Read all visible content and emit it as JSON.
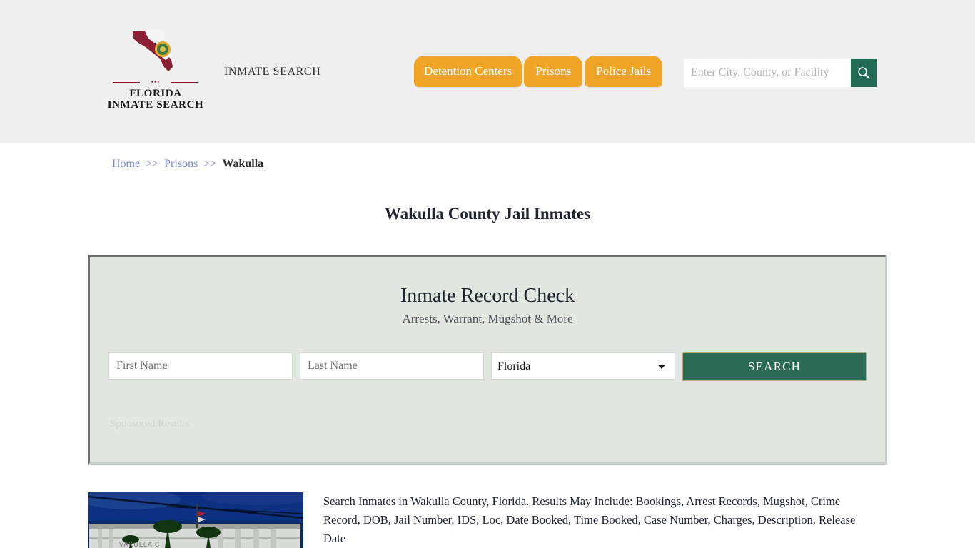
{
  "header": {
    "logo": {
      "icon": "florida-state-map-icon",
      "line1": "FLORIDA",
      "line2": "INMATE SEARCH",
      "dots": "•••"
    },
    "tagline": "INMATE SEARCH",
    "nav": [
      {
        "label": "Detention Centers"
      },
      {
        "label": "Prisons"
      },
      {
        "label": "Police Jails"
      }
    ],
    "search": {
      "placeholder": "Enter City, County, or Facility",
      "value": "",
      "button_icon": "search-icon"
    },
    "background_color": "#efefef",
    "tab_color": "#f0a526",
    "search_button_color": "#216b54"
  },
  "breadcrumb": {
    "home": "Home",
    "sep1": ">>",
    "prisons": "Prisons",
    "sep2": ">>",
    "current": "Wakulla",
    "link_color": "#7b88d6"
  },
  "page": {
    "title": "Wakulla County Jail Inmates"
  },
  "record_check": {
    "title": "Inmate Record Check",
    "subtitle": "Arrests, Warrant, Mugshot & More",
    "first_name_placeholder": "First Name",
    "first_name_value": "",
    "last_name_placeholder": "Last Name",
    "last_name_value": "",
    "state_selected": "Florida",
    "state_options": [
      "Florida"
    ],
    "search_button": "SEARCH",
    "sponsored_label": "Sponsored Results",
    "panel_color": "#e2e7e1",
    "button_color": "#2c6b55"
  },
  "content": {
    "thumbnail_alt": "wakulla-county-courthouse-photo",
    "description": "Search Inmates in Wakulla County, Florida. Results May Include: Bookings, Arrest Records, Mugshot, Crime Record, DOB, Jail Number, IDS, Loc, Date Booked, Time Booked, Case Number, Charges, Description, Release Date"
  }
}
